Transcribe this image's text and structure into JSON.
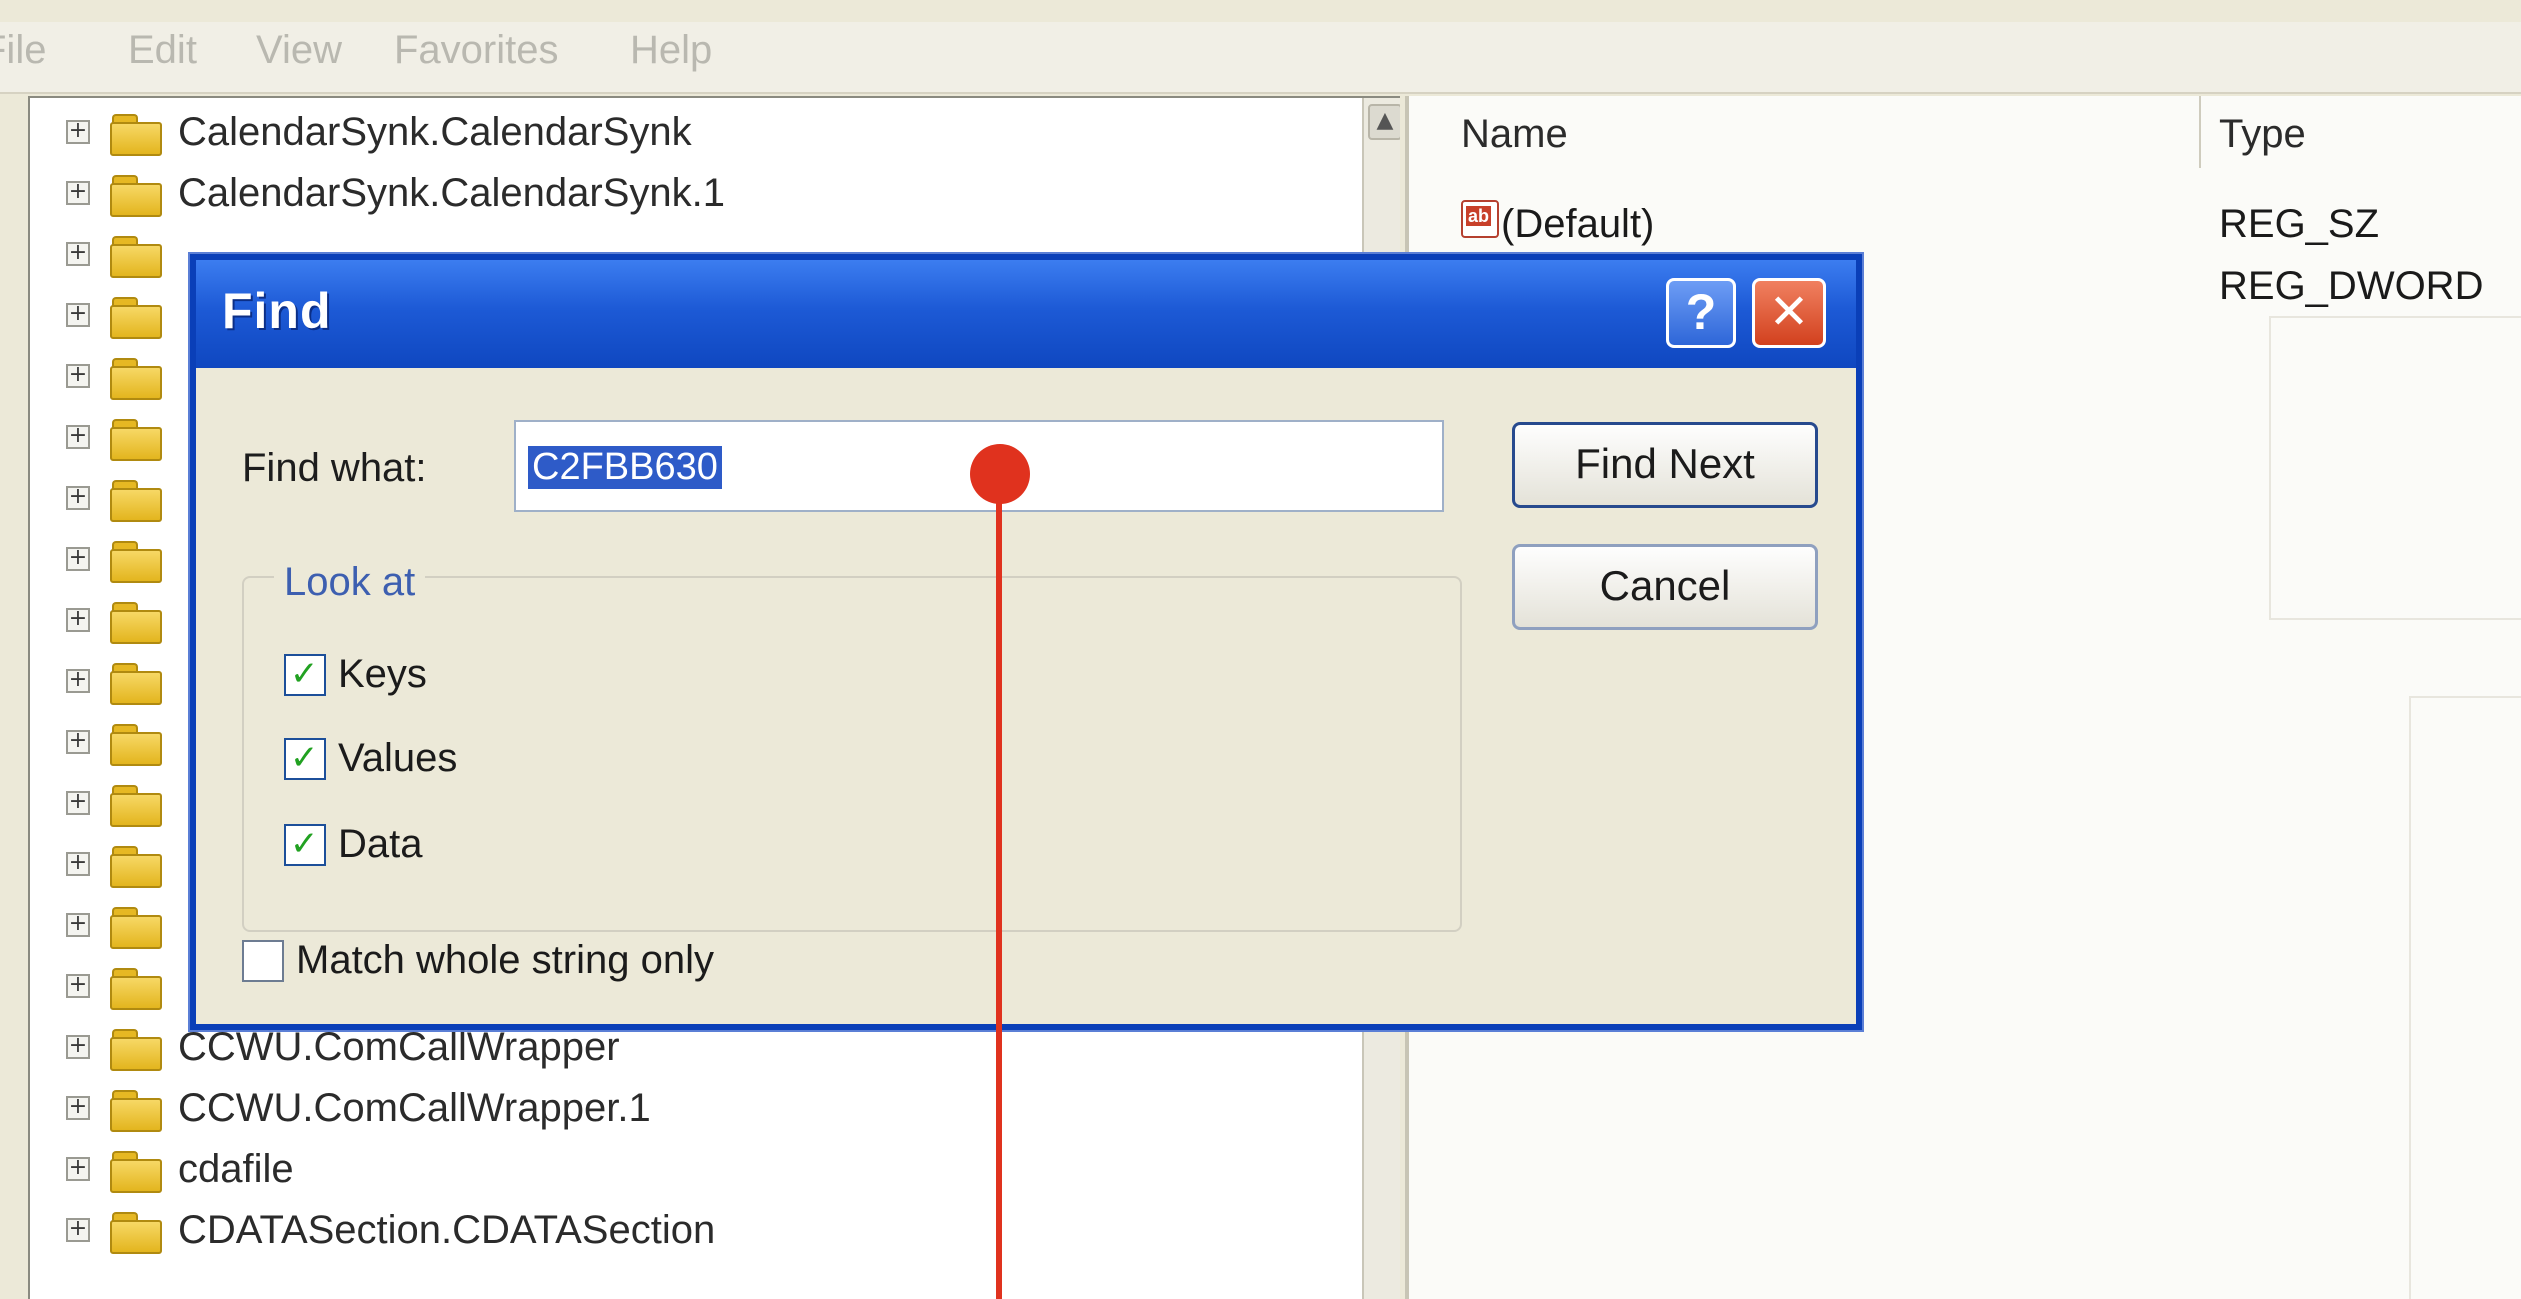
{
  "menu": [
    "File",
    "Edit",
    "View",
    "Favorites",
    "Help"
  ],
  "tree": {
    "items": [
      {
        "label": "CalendarSynk.CalendarSynk"
      },
      {
        "label": "CalendarSynk.CalendarSynk.1"
      },
      {
        "label": ""
      },
      {
        "label": ""
      },
      {
        "label": ""
      },
      {
        "label": ""
      },
      {
        "label": ""
      },
      {
        "label": ""
      },
      {
        "label": ""
      },
      {
        "label": ""
      },
      {
        "label": ""
      },
      {
        "label": ""
      },
      {
        "label": ""
      },
      {
        "label": ""
      },
      {
        "label": ""
      },
      {
        "label": "CCWU.ComCallWrapper"
      },
      {
        "label": "CCWU.ComCallWrapper.1"
      },
      {
        "label": "cdafile"
      },
      {
        "label": "CDATASection.CDATASection"
      }
    ],
    "expander_glyph": "+"
  },
  "list": {
    "columns": [
      "Name",
      "Type"
    ],
    "rows": [
      {
        "icon": "ab",
        "name": "(Default)",
        "type": "REG_SZ"
      },
      {
        "icon": "",
        "name": "",
        "type": "REG_DWORD"
      }
    ]
  },
  "dialog": {
    "title": "Find",
    "help_glyph": "?",
    "close_glyph": "✕",
    "find_what_label": "Find what:",
    "find_what_value": "C2FBB630",
    "find_next_label": "Find Next",
    "cancel_label": "Cancel",
    "look_at_label": "Look at",
    "checkboxes": [
      {
        "label": "Keys",
        "checked": true
      },
      {
        "label": "Values",
        "checked": true
      },
      {
        "label": "Data",
        "checked": true
      }
    ],
    "match_whole_label": "Match whole string only",
    "match_whole_checked": false,
    "check_glyph": "✓"
  },
  "colors": {
    "titlebar": "#1d5ad6",
    "annotation": "#e0321e",
    "folder": "#e6b823"
  }
}
